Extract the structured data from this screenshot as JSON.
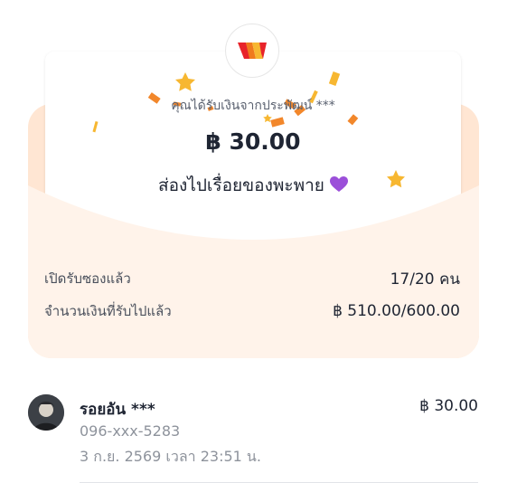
{
  "envelope": {
    "sender_text": "คุณได้รับเงินจากประพัฒน์ ***",
    "amount": "฿ 30.00",
    "message": "ส่องไปเรื่อยของพะพาย",
    "message_emoji": "purple-heart-icon"
  },
  "stats": {
    "opened_label": "เปิดรับซองแล้ว",
    "opened_value": "17/20 คน",
    "received_label": "จำนวนเงินที่รับไปแล้ว",
    "received_value": "฿ 510.00/600.00"
  },
  "recipients": [
    {
      "name": "รอยอัน ***",
      "phone": "096-xxx-5283",
      "time": "3 ก.ย. 2569 เวลา 23:51 น.",
      "amount": "฿ 30.00"
    }
  ],
  "colors": {
    "envelope": "#ffe6d3",
    "envelope_front": "#fff3ea",
    "confetti_orange": "#f2872b",
    "star_gold": "#f7b731",
    "heart": "#9b4fd9"
  }
}
